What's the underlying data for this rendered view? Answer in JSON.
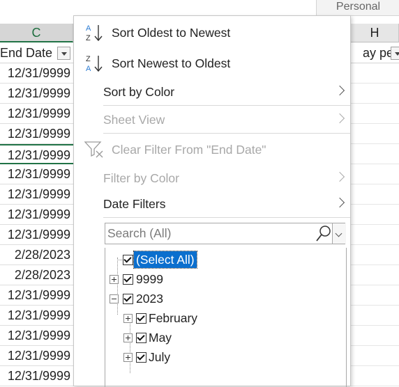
{
  "sheet": {
    "personal_label": "Personal",
    "col_c_letter": "C",
    "col_h_letter": "H",
    "col_c_header": "End Date",
    "col_h_header": "ay per",
    "end_dates": [
      "12/31/9999",
      "12/31/9999",
      "12/31/9999",
      "12/31/9999",
      "12/31/9999",
      "12/31/9999",
      "12/31/9999",
      "12/31/9999",
      "12/31/9999",
      "2/28/2023",
      "2/28/2023",
      "12/31/9999",
      "12/31/9999",
      "12/31/9999",
      "12/31/9999",
      "12/31/9999"
    ]
  },
  "menu": {
    "sort_oldest": "Sort Oldest to Newest",
    "sort_newest": "Sort Newest to Oldest",
    "sort_by_color": "Sort by Color",
    "sheet_view": "Sheet View",
    "clear_filter": "Clear Filter From \"End Date\"",
    "filter_by_color": "Filter by Color",
    "date_filters": "Date Filters",
    "search_placeholder": "Search (All)"
  },
  "tree": {
    "select_all": "(Select All)",
    "year_9999": "9999",
    "year_2023": "2023",
    "months": [
      "February",
      "May",
      "July"
    ]
  },
  "colors": {
    "accent": "#217346",
    "selection": "#0b6fce",
    "sort_icon_blue": "#2b7cd3"
  }
}
